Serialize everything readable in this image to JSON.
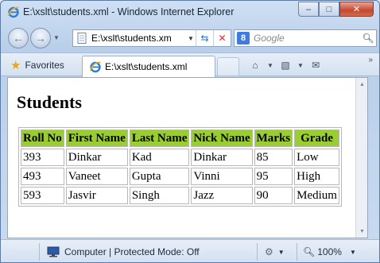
{
  "window": {
    "title": "E:\\xslt\\students.xml - Windows Internet Explorer",
    "buttons": {
      "minimize": "–",
      "maximize": "□",
      "close": "✕"
    }
  },
  "address_bar": {
    "url": "E:\\xslt\\students.xm",
    "search_placeholder": "Google"
  },
  "favorites_bar": {
    "favorites_label": "Favorites",
    "tab_label": "E:\\xslt\\students.xml"
  },
  "page": {
    "title": "Students",
    "table": {
      "headers": [
        "Roll No",
        "First Name",
        "Last Name",
        "Nick Name",
        "Marks",
        "Grade"
      ],
      "rows": [
        [
          "393",
          "Dinkar",
          "Kad",
          "Dinkar",
          "85",
          "Low"
        ],
        [
          "493",
          "Vaneet",
          "Gupta",
          "Vinni",
          "95",
          "High"
        ],
        [
          "593",
          "Jasvir",
          "Singh",
          "Jazz",
          "90",
          "Medium"
        ]
      ]
    },
    "header_color": "#9acd32"
  },
  "status_bar": {
    "zone_text": "Computer | Protected Mode: Off",
    "zoom": "100%"
  },
  "icons": {
    "browser": "ie-icon",
    "back": "back-arrow-icon",
    "forward": "forward-arrow-icon",
    "refresh": "refresh-icon",
    "stop": "stop-icon",
    "search_provider": "google-icon",
    "search": "magnifier-icon",
    "favorites": "star-icon",
    "home": "home-icon",
    "feeds": "rss-icon",
    "mail": "mail-icon",
    "zone": "computer-zone-icon",
    "zoom": "zoom-icon"
  }
}
